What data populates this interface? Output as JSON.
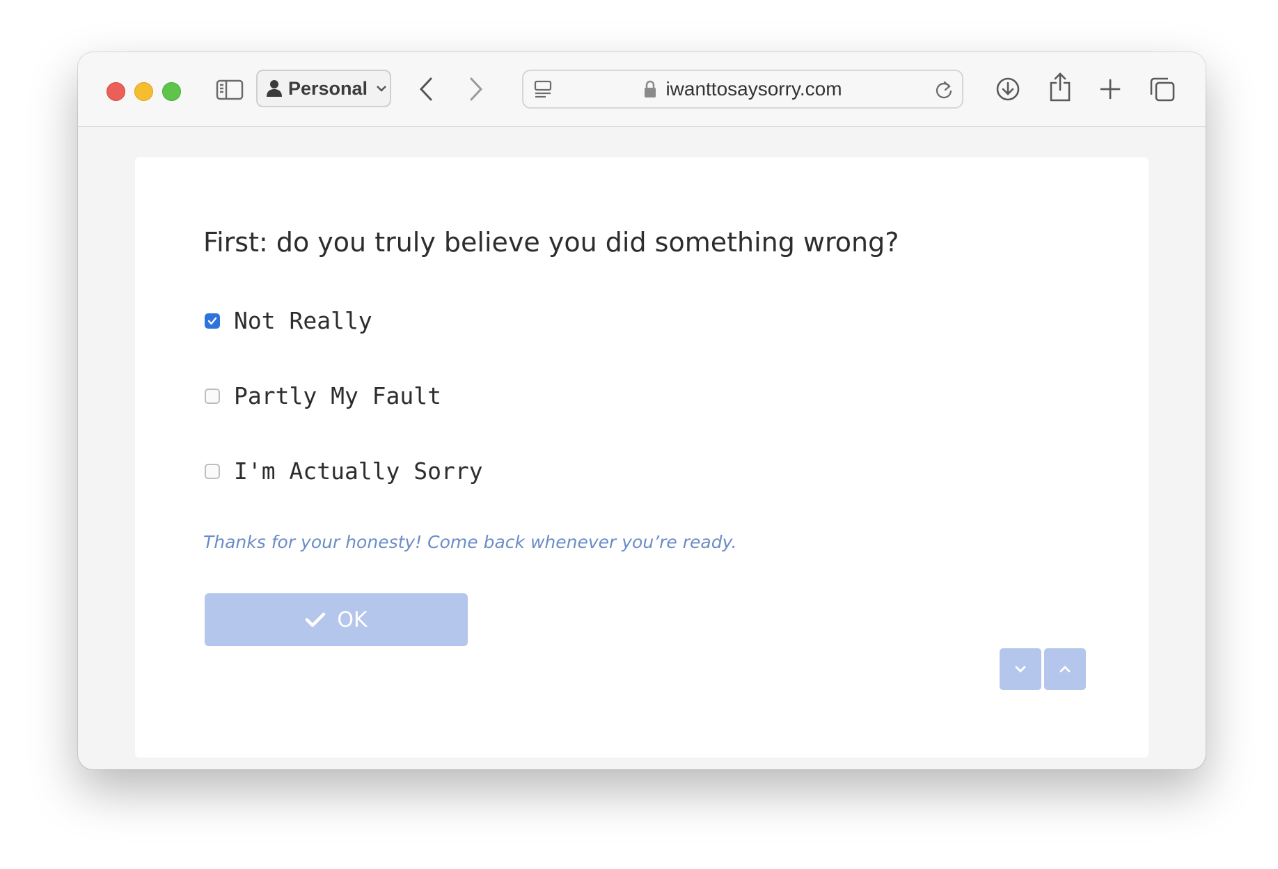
{
  "browser": {
    "profile_label": "Personal",
    "url": "iwanttosaysorry.com"
  },
  "form": {
    "question": "First: do you truly believe you did something wrong?",
    "options": [
      {
        "label": "Not Really",
        "checked": true
      },
      {
        "label": "Partly My Fault",
        "checked": false
      },
      {
        "label": "I'm Actually Sorry",
        "checked": false
      }
    ],
    "feedback": "Thanks for your honesty! Come back whenever you’re ready.",
    "ok_label": "OK"
  },
  "colors": {
    "accent": "#2e72de",
    "button": "#b4c6ec",
    "feedback_text": "#6a8dc7"
  },
  "icons": {
    "sidebar": "sidebar-icon",
    "profile": "person-icon",
    "back": "chevron-left-icon",
    "forward": "chevron-right-icon",
    "page": "page-menu-icon",
    "lock": "lock-icon",
    "reload": "reload-icon",
    "download": "download-icon",
    "share": "share-icon",
    "new_tab": "plus-icon",
    "tabs": "tab-overview-icon",
    "ok_check": "checkmark-icon",
    "down": "chevron-down-icon",
    "up": "chevron-up-icon"
  }
}
